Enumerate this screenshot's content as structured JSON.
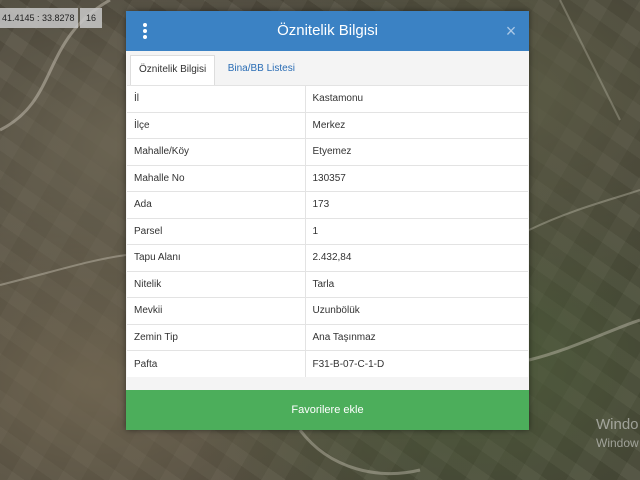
{
  "map": {
    "coordinates": "41.4145 : 33.8278",
    "zoom_level": "16",
    "watermark_line1": "Windo",
    "watermark_line2": "Window"
  },
  "dialog": {
    "title": "Öznitelik Bilgisi",
    "close_symbol": "×",
    "tabs": [
      {
        "label": "Öznitelik Bilgisi",
        "active": true
      },
      {
        "label": "Bina/BB Listesi",
        "active": false
      }
    ],
    "rows": [
      {
        "key": "İl",
        "value": "Kastamonu"
      },
      {
        "key": "İlçe",
        "value": "Merkez"
      },
      {
        "key": "Mahalle/Köy",
        "value": "Etyemez"
      },
      {
        "key": "Mahalle No",
        "value": "130357"
      },
      {
        "key": "Ada",
        "value": "173"
      },
      {
        "key": "Parsel",
        "value": "1"
      },
      {
        "key": "Tapu Alanı",
        "value": "2.432,84"
      },
      {
        "key": "Nitelik",
        "value": "Tarla"
      },
      {
        "key": "Mevkii",
        "value": "Uzunbölük"
      },
      {
        "key": "Zemin Tip",
        "value": "Ana Taşınmaz"
      },
      {
        "key": "Pafta",
        "value": "F31-B-07-C-1-D"
      }
    ],
    "favorite_button": "Favorilere ekle"
  },
  "colors": {
    "header": "#3b82c4",
    "button": "#4cae5b",
    "tab_link": "#2a6db5"
  }
}
